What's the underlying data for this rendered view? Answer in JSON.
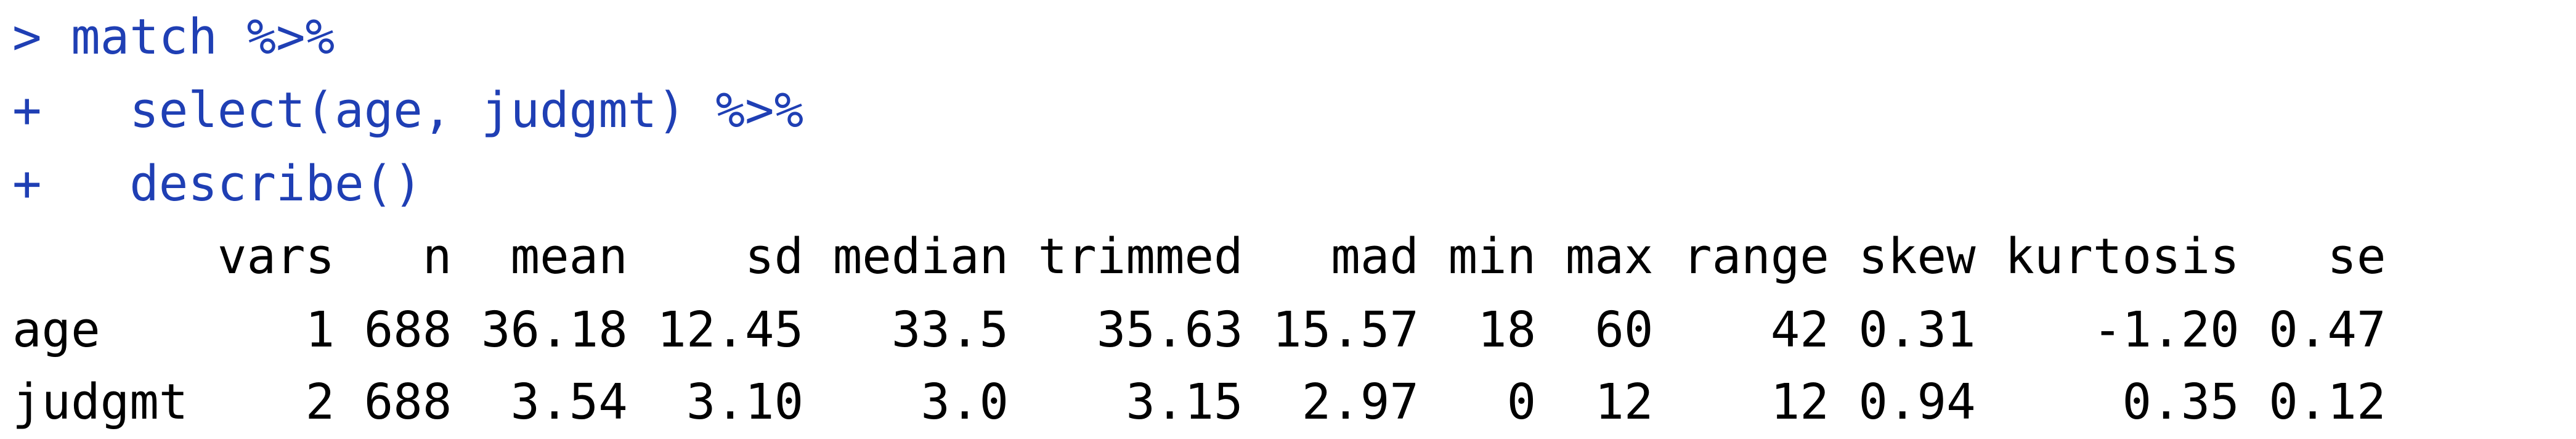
{
  "console": {
    "commands": [
      "> match %>%",
      "+   select(age, judgmt) %>%",
      "+   describe()"
    ],
    "output": {
      "header": "       vars   n  mean    sd median trimmed   mad min max range skew kurtosis   se",
      "rows": [
        "age       1 688 36.18 12.45   33.5   35.63 15.57  18  60    42 0.31    -1.20 0.47",
        "judgmt    2 688  3.54  3.10    3.0    3.15  2.97   0  12    12 0.94     0.35 0.12"
      ]
    },
    "colors": {
      "command_text": "#1f3fb4",
      "output_text": "#000000",
      "background": "#ffffff"
    }
  }
}
